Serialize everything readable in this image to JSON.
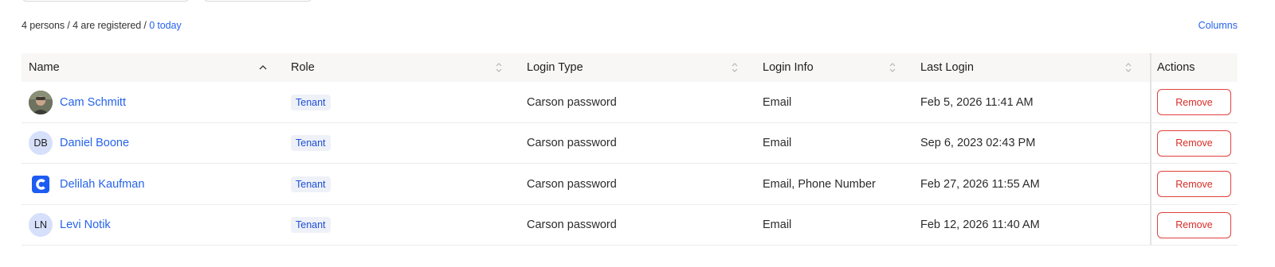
{
  "summary": {
    "persons": "4 persons / 4 are registered / ",
    "today_link": "0 today"
  },
  "columns_link": "Columns",
  "table": {
    "headers": {
      "name": "Name",
      "role": "Role",
      "login_type": "Login Type",
      "login_info": "Login Info",
      "last_login": "Last Login",
      "actions": "Actions"
    },
    "sort": {
      "column": "name",
      "direction": "ascending"
    },
    "rows": [
      {
        "avatar_type": "photo",
        "initials": "",
        "name": "Cam Schmitt",
        "role": "Tenant",
        "login_type": "Carson password",
        "login_info": "Email",
        "last_login": "Feb 5, 2026 11:41 AM",
        "action": "Remove"
      },
      {
        "avatar_type": "initials",
        "initials": "DB",
        "name": "Daniel Boone",
        "role": "Tenant",
        "login_type": "Carson password",
        "login_info": "Email",
        "last_login": "Sep 6, 2023 02:43 PM",
        "action": "Remove"
      },
      {
        "avatar_type": "logo",
        "initials": "",
        "name": "Delilah Kaufman",
        "role": "Tenant",
        "login_type": "Carson password",
        "login_info": "Email, Phone Number",
        "last_login": "Feb 27, 2026 11:55 AM",
        "action": "Remove"
      },
      {
        "avatar_type": "initials",
        "initials": "LN",
        "name": "Levi Notik",
        "role": "Tenant",
        "login_type": "Carson password",
        "login_info": "Email",
        "last_login": "Feb 12, 2026 11:40 AM",
        "action": "Remove"
      }
    ]
  },
  "colors": {
    "link": "#2563eb",
    "remove": "#d92d27",
    "badge_bg": "#eef1f7",
    "header_bg": "#f8f7f5",
    "avatar_bg": "#d6e0fb"
  }
}
